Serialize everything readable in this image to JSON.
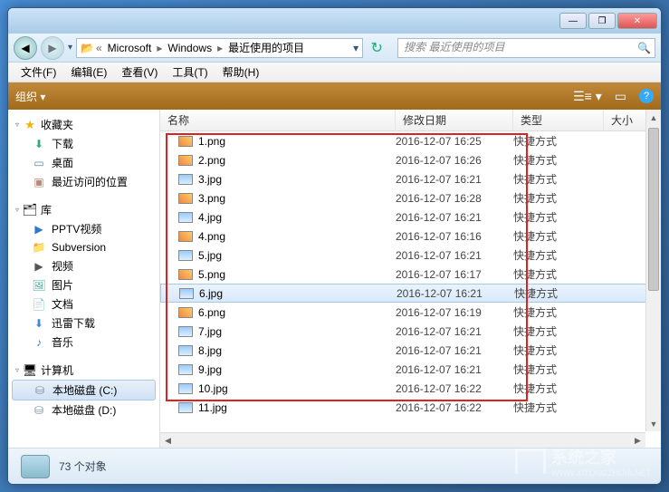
{
  "titlebar": {
    "min": "—",
    "max": "❐",
    "close": "✕"
  },
  "nav": {
    "back": "◀",
    "fwd": "▶",
    "dd": "▾",
    "crumbs": [
      "Microsoft",
      "Windows",
      "最近使用的项目"
    ],
    "refresh": "↻",
    "search_placeholder": "搜索 最近使用的项目"
  },
  "menu": {
    "file": "文件(F)",
    "edit": "编辑(E)",
    "view": "查看(V)",
    "tools": "工具(T)",
    "help": "帮助(H)"
  },
  "toolbar": {
    "organize": "组织 ▾",
    "view_icon": "☰≡ ▾",
    "preview_icon": "▭",
    "help_icon": "?"
  },
  "sidebar": {
    "fav": {
      "label": "收藏夹",
      "items": [
        "下载",
        "桌面",
        "最近访问的位置"
      ]
    },
    "lib": {
      "label": "库",
      "items": [
        "PPTV视频",
        "Subversion",
        "视频",
        "图片",
        "文档",
        "迅雷下载",
        "音乐"
      ]
    },
    "comp": {
      "label": "计算机",
      "items": [
        "本地磁盘 (C:)",
        "本地磁盘 (D:)"
      ]
    }
  },
  "columns": {
    "name": "名称",
    "date": "修改日期",
    "type": "类型",
    "size": "大小"
  },
  "file_type_label": "快捷方式",
  "files": [
    {
      "n": "1.png",
      "d": "2016-12-07 16:25",
      "e": "png"
    },
    {
      "n": "2.png",
      "d": "2016-12-07 16:26",
      "e": "png"
    },
    {
      "n": "3.jpg",
      "d": "2016-12-07 16:21",
      "e": "jpg"
    },
    {
      "n": "3.png",
      "d": "2016-12-07 16:28",
      "e": "png"
    },
    {
      "n": "4.jpg",
      "d": "2016-12-07 16:21",
      "e": "jpg"
    },
    {
      "n": "4.png",
      "d": "2016-12-07 16:16",
      "e": "png"
    },
    {
      "n": "5.jpg",
      "d": "2016-12-07 16:21",
      "e": "jpg"
    },
    {
      "n": "5.png",
      "d": "2016-12-07 16:17",
      "e": "png"
    },
    {
      "n": "6.jpg",
      "d": "2016-12-07 16:21",
      "e": "jpg",
      "sel": true
    },
    {
      "n": "6.png",
      "d": "2016-12-07 16:19",
      "e": "png"
    },
    {
      "n": "7.jpg",
      "d": "2016-12-07 16:21",
      "e": "jpg"
    },
    {
      "n": "8.jpg",
      "d": "2016-12-07 16:21",
      "e": "jpg"
    },
    {
      "n": "9.jpg",
      "d": "2016-12-07 16:21",
      "e": "jpg"
    },
    {
      "n": "10.jpg",
      "d": "2016-12-07 16:22",
      "e": "jpg"
    },
    {
      "n": "11.jpg",
      "d": "2016-12-07 16:22",
      "e": "jpg"
    }
  ],
  "status": {
    "count": "73 个对象"
  },
  "watermark": {
    "text": "系统之家",
    "url": "WWW.XITONGZHIJIA.NET"
  },
  "icons": {
    "fav": "★",
    "dl": "⬇",
    "desk": "▭",
    "recent": "▣",
    "lib": "🗂",
    "video": "▶",
    "svn": "📁",
    "img": "🖼",
    "doc": "📄",
    "xl": "⬇",
    "music": "♪",
    "comp": "🖥",
    "disk": "⛁"
  }
}
